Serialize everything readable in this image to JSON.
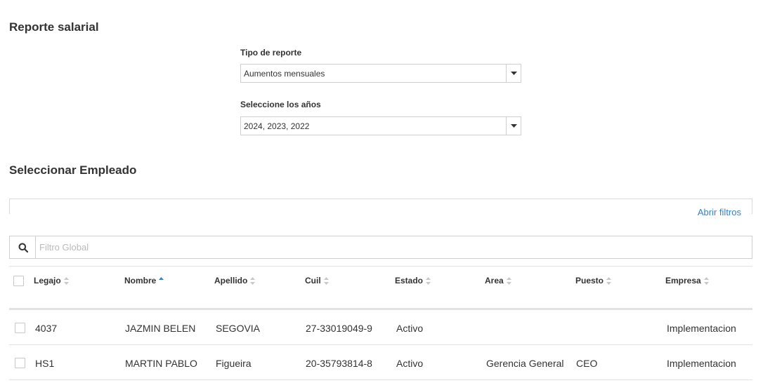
{
  "page": {
    "title": "Reporte salarial",
    "tipo_label": "Tipo de reporte",
    "tipo_value": "Aumentos mensuales",
    "anios_label": "Seleccione los años",
    "anios_value": "2024, 2023, 2022",
    "employee_title": "Seleccionar Empleado",
    "open_filters": "Abrir filtros",
    "search_placeholder": "Filtro Global"
  },
  "table": {
    "columns": [
      "Legajo",
      "Nombre",
      "Apellido",
      "Cuil",
      "Estado",
      "Area",
      "Puesto",
      "Empresa"
    ],
    "sorted_column": "Nombre",
    "sort_direction": "asc",
    "rows": [
      [
        "4037",
        "JAZMIN BELEN",
        "SEGOVIA",
        "27-33019049-9",
        "Activo",
        "",
        "",
        "Implementacion"
      ],
      [
        "HS1",
        "MARTIN PABLO",
        "Figueira",
        "20-35793814-8",
        "Activo",
        "Gerencia General",
        "CEO",
        "Implementacion"
      ]
    ]
  },
  "icons": {
    "search": "search-icon",
    "caret": "chevron-down-icon",
    "sort": "sort-icon",
    "sort_asc": "sort-asc-icon"
  },
  "colors": {
    "link": "#3a7fc1",
    "sort_active": "#3a7fc1",
    "sort_idle": "#c8c8c8",
    "border": "#cfcfcf"
  }
}
